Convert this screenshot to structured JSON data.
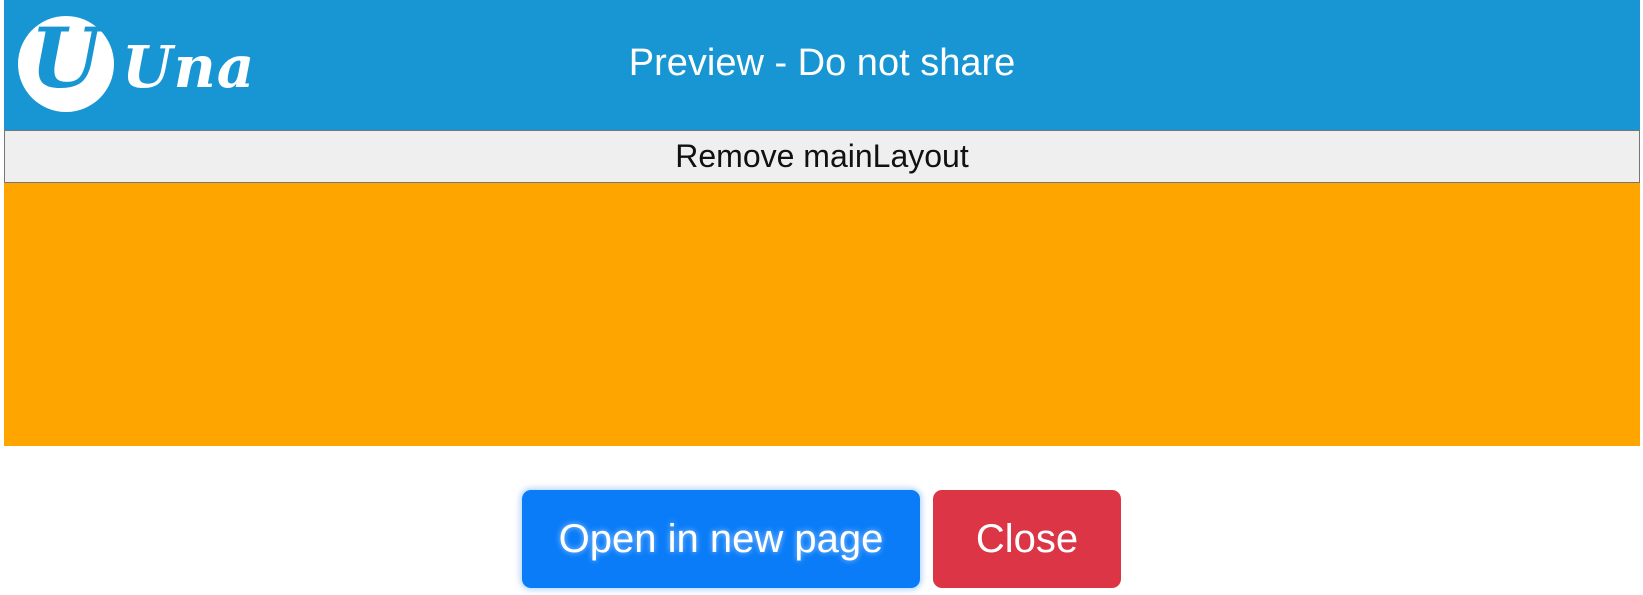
{
  "header": {
    "logo_letter": "U",
    "logo_text": "Una",
    "title": "Preview - Do not share",
    "background": "#1896d4"
  },
  "toolbar": {
    "remove_label": "Remove mainLayout"
  },
  "content": {
    "background": "#ffa500"
  },
  "actions": {
    "open_label": "Open in new page",
    "close_label": "Close",
    "open_color": "#0a7cf8",
    "close_color": "#dc3545"
  }
}
